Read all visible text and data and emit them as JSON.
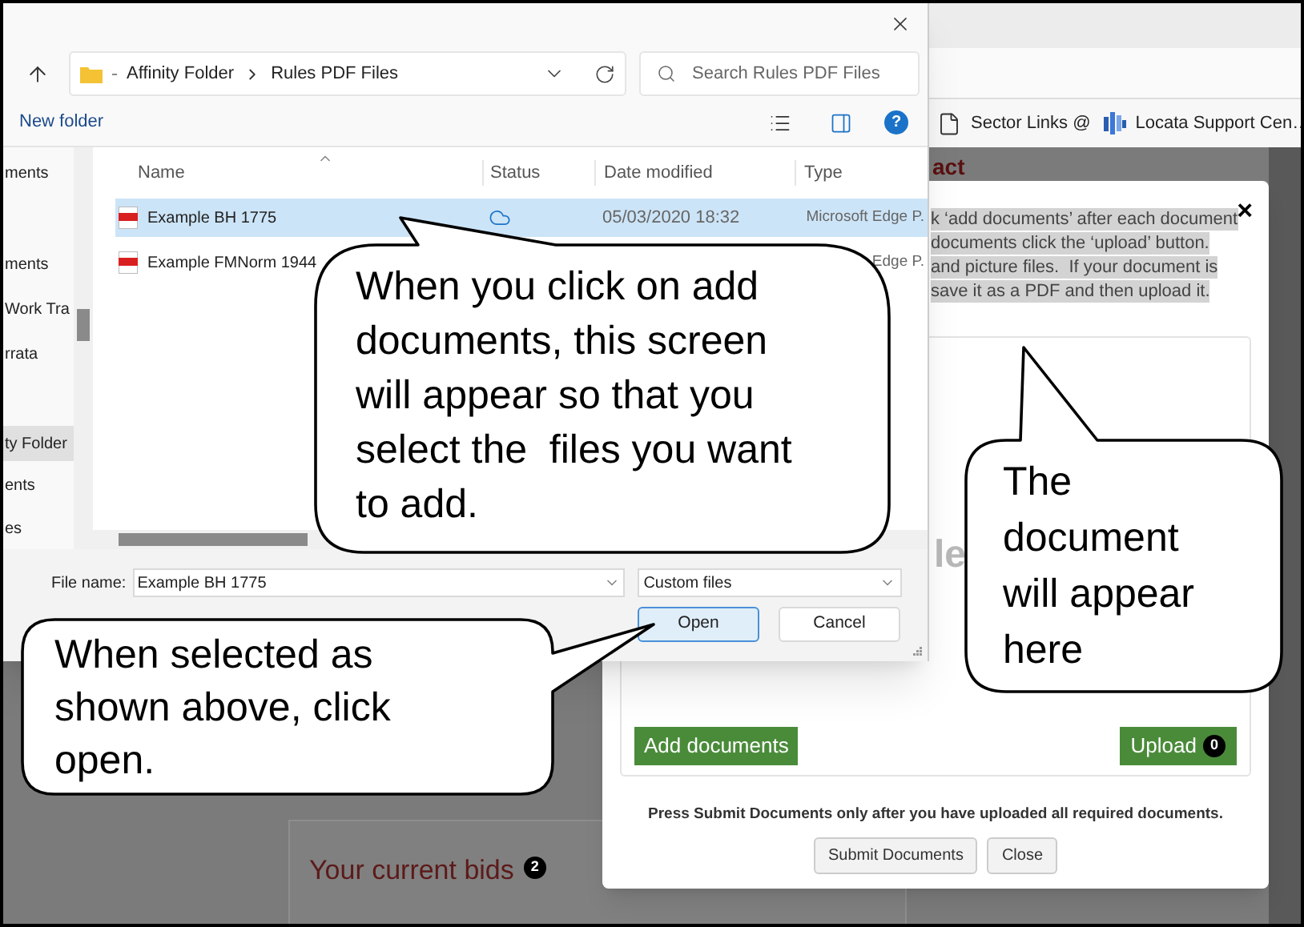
{
  "browser": {
    "bookmarks": [
      {
        "label": "Sector Links @",
        "kind": "page"
      },
      {
        "label": "Locata Support Cen…",
        "kind": "site"
      }
    ]
  },
  "page": {
    "heading_fragment": "act",
    "card_title": "Your current bids",
    "card_badge": "2"
  },
  "modal": {
    "close": "×",
    "instructions": [
      "k ‘add documents’ after each document",
      "documents click the ‘upload’ button.",
      "and picture files.  If your document is",
      "save it as a PDF and then upload it."
    ],
    "drop_area_text": "le",
    "add_button": "Add documents",
    "upload_button": "Upload",
    "upload_badge": "0",
    "note": "Press Submit Documents only after you have uploaded all required documents.",
    "buttons": [
      {
        "label": "Submit Documents"
      },
      {
        "label": "Close"
      }
    ]
  },
  "file_dialog": {
    "path": [
      "Affinity Folder",
      "Rules PDF Files"
    ],
    "search_placeholder": "Search Rules PDF Files",
    "new_folder": "New folder",
    "help": "?",
    "nav_items": [
      {
        "label": "ments",
        "selected": false
      },
      {
        "label": "ments",
        "selected": false
      },
      {
        "label": "Work Tra",
        "selected": false
      },
      {
        "label": "rrata",
        "selected": false
      },
      {
        "label": "ty Folder",
        "selected": true
      },
      {
        "label": "ents",
        "selected": false
      },
      {
        "label": "es",
        "selected": false
      }
    ],
    "columns": [
      "Name",
      "Status",
      "Date modified",
      "Type"
    ],
    "files": [
      {
        "name": "Example BH 1775",
        "cloud": true,
        "date": "05/03/2020 18:32",
        "type": "Microsoft Edge P.",
        "selected": true
      },
      {
        "name": "Example FMNorm 1944",
        "type": "Edge P.",
        "selected": false
      }
    ],
    "file_name_label": "File name:",
    "file_name": "Example BH 1775",
    "filter": "Custom files",
    "buttons": [
      {
        "label": "Open",
        "default": true
      },
      {
        "label": "Cancel",
        "default": false
      }
    ]
  },
  "callouts": [
    {
      "text": "When you click on add documents, this screen will appear so that you select the  files you want to add."
    },
    {
      "text": "The document will appear here"
    },
    {
      "text": "When selected as shown above, click open."
    }
  ]
}
